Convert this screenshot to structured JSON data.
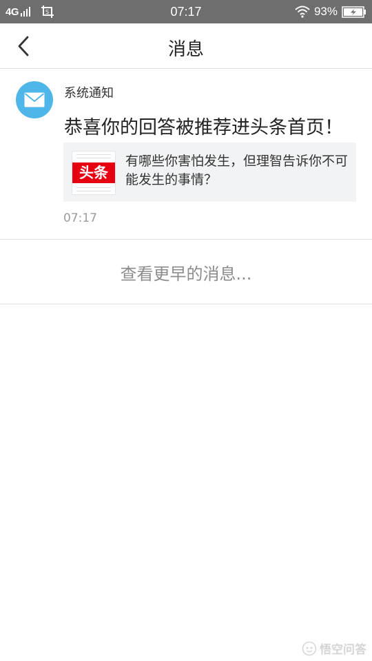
{
  "status_bar": {
    "network": "4G",
    "time": "07:17",
    "battery_percent": "93%",
    "icons": [
      "signal-icon",
      "screenshot-icon",
      "wifi-icon",
      "battery-charging-icon"
    ]
  },
  "header": {
    "title": "消息",
    "back_icon": "back-arrow-icon"
  },
  "messages": [
    {
      "sender": "系统通知",
      "avatar_icon": "mail-icon",
      "avatar_color": "#4eb6e8",
      "text": "恭喜你的回答被推荐进头条首页！",
      "attachment": {
        "thumb_label": "头条",
        "thumb_color": "#e60012",
        "title": "有哪些你害怕发生，但理智告诉你不可能发生的事情？"
      },
      "time": "07:17"
    }
  ],
  "load_earlier": {
    "label": "查看更早的消息..."
  },
  "watermark": {
    "text": "悟空问答",
    "icon": "wukong-logo-icon"
  }
}
